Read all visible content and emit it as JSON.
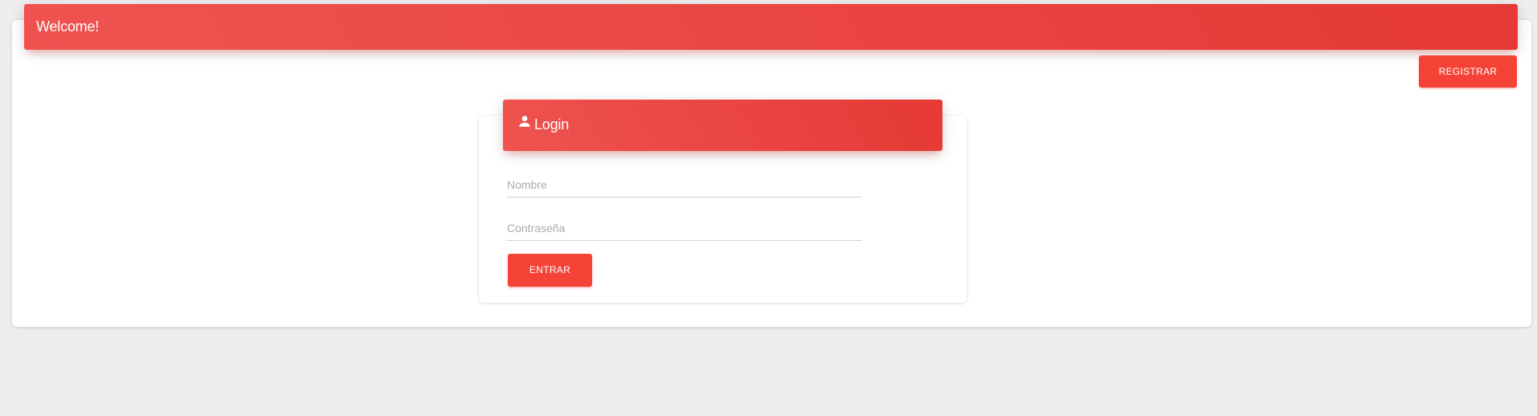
{
  "header": {
    "title": "Welcome!"
  },
  "actions": {
    "register_label": "REGISTRAR"
  },
  "login": {
    "icon": "person-icon",
    "title": "Login",
    "name_placeholder": "Nombre",
    "password_placeholder": "Contraseña",
    "submit_label": "ENTRAR"
  },
  "colors": {
    "accent": "#f44336",
    "header_gradient_start": "#ef5350",
    "header_gradient_end": "#e53935",
    "background": "#eeeeee"
  }
}
